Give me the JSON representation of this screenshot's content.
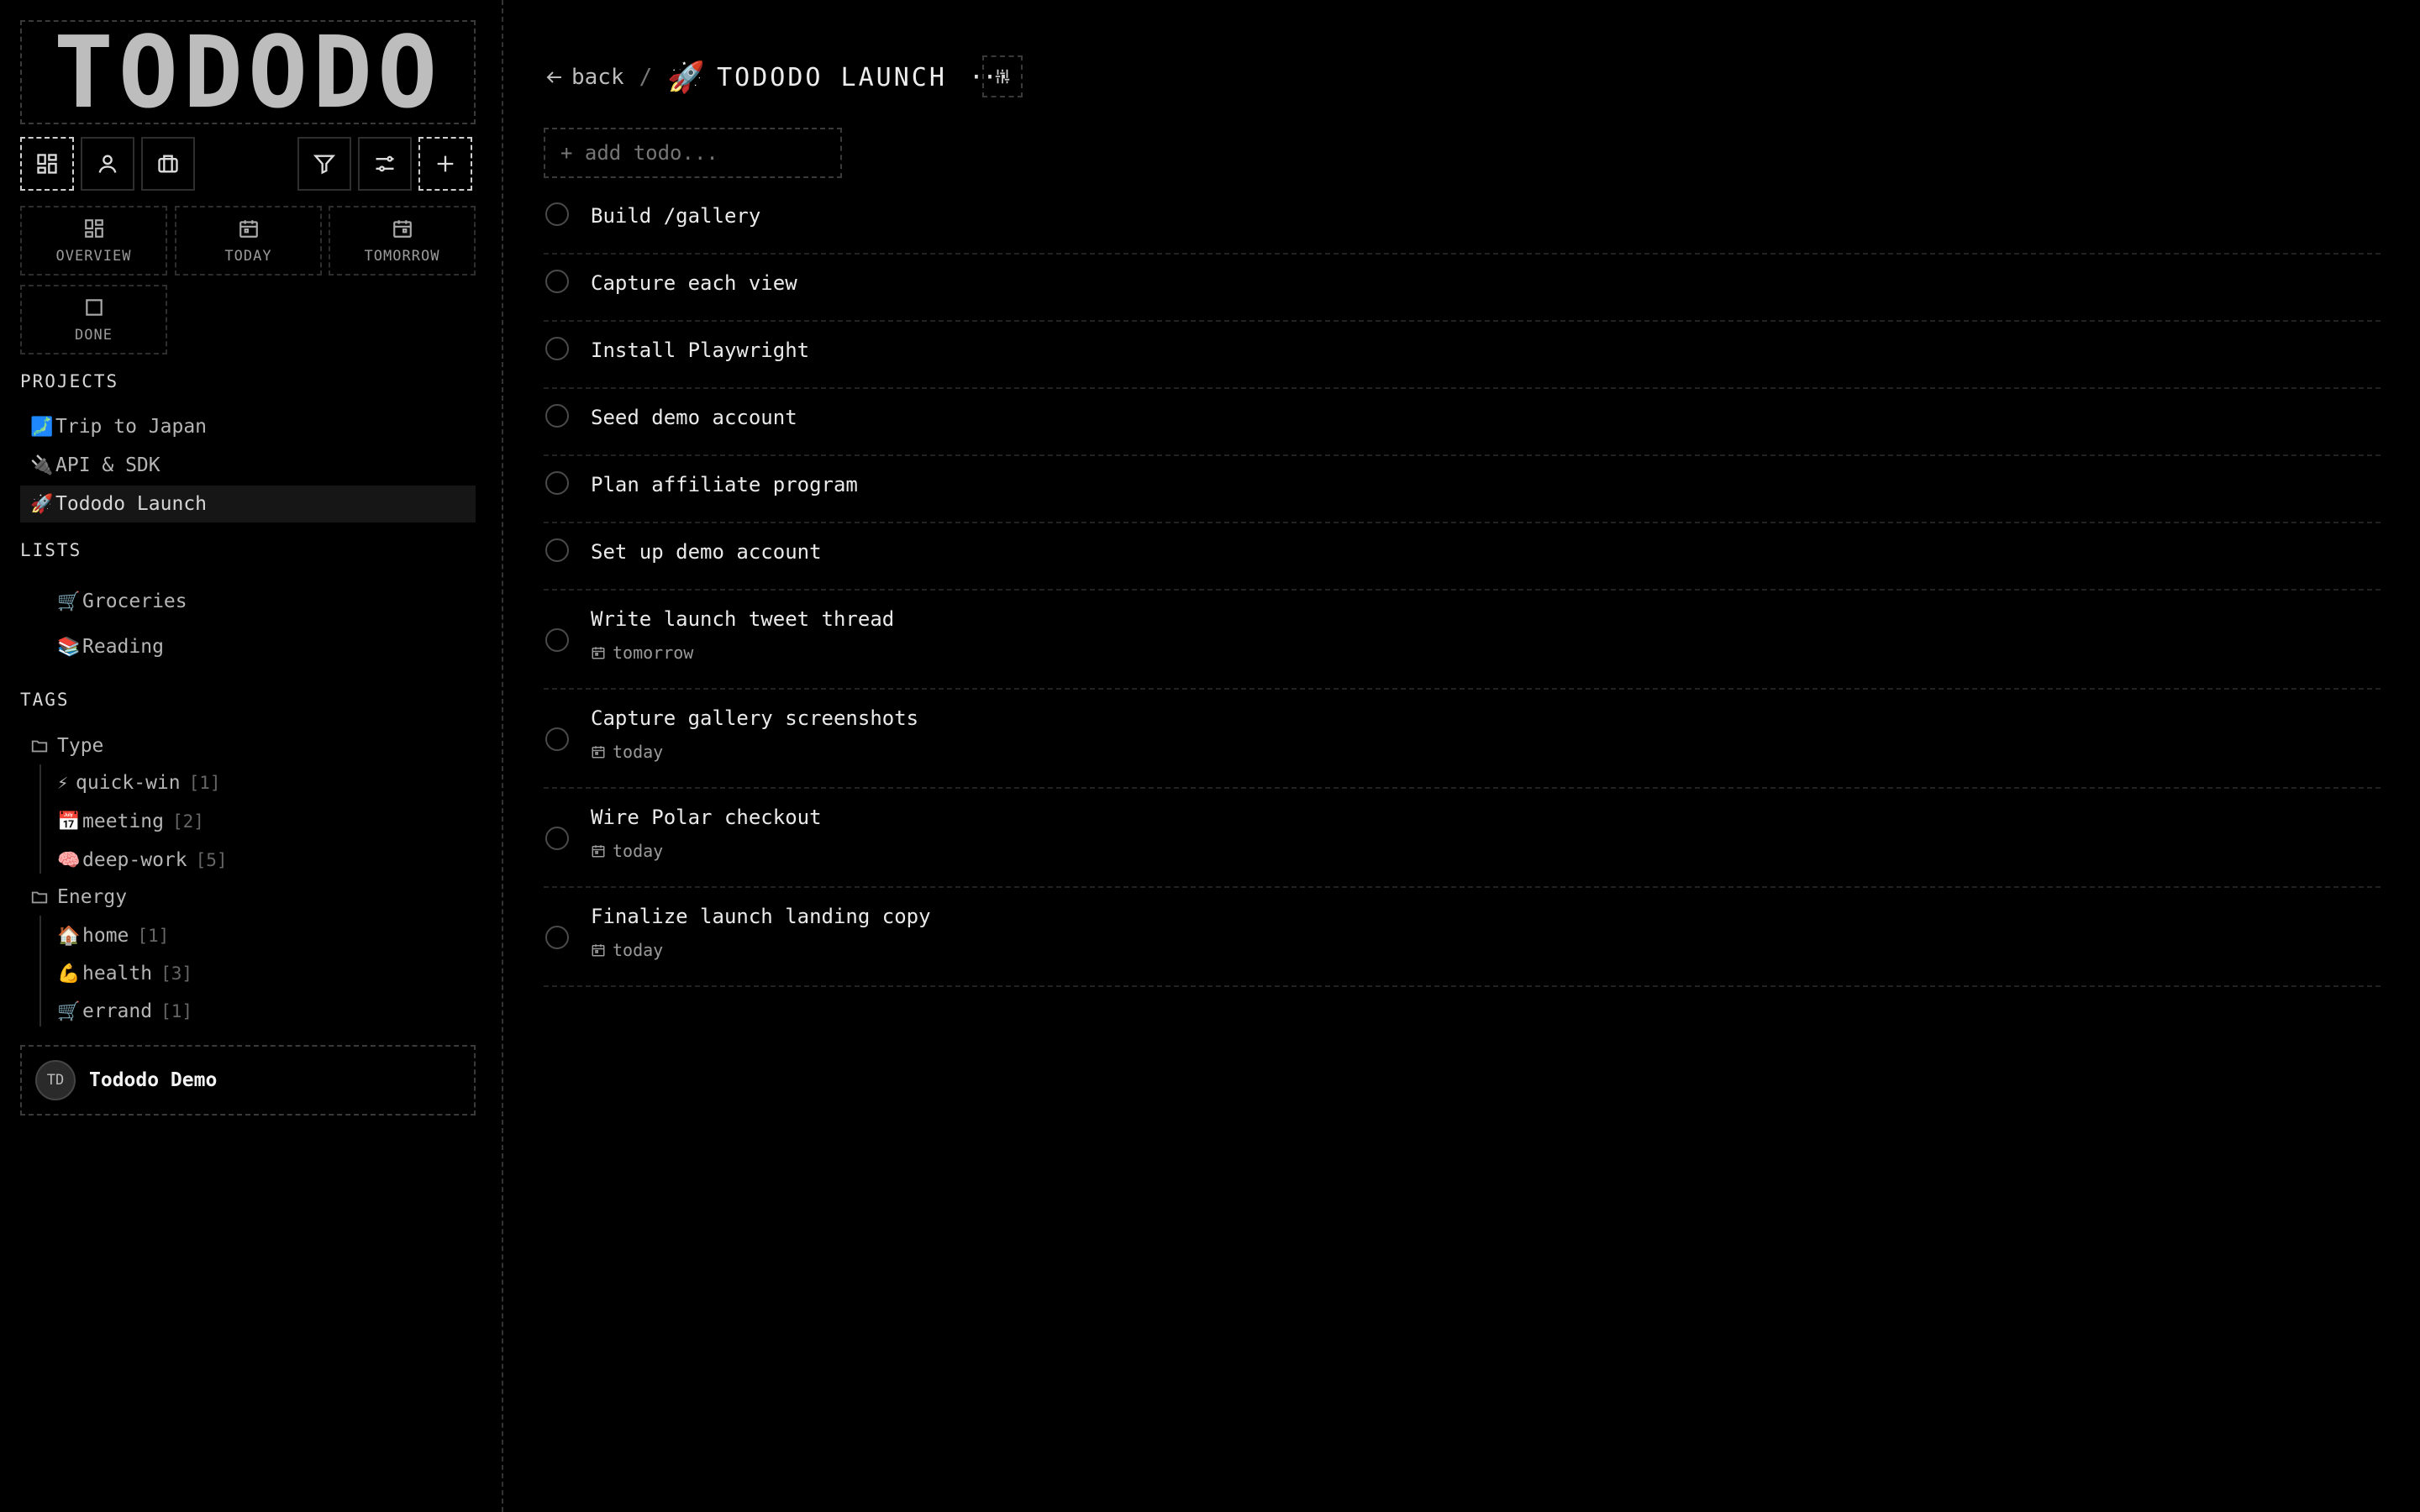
{
  "app": {
    "logo": "TODODO"
  },
  "toolbar": {
    "left_buttons": [
      "grid-icon",
      "person-icon",
      "briefcase-icon"
    ],
    "right_buttons": [
      "filter-icon",
      "sliders-icon",
      "plus-icon"
    ]
  },
  "views": [
    {
      "label": "OVERVIEW",
      "icon": "grid-icon"
    },
    {
      "label": "TODAY",
      "icon": "calendar-icon"
    },
    {
      "label": "TOMORROW",
      "icon": "calendar-icon"
    },
    {
      "label": "DONE",
      "icon": "square-icon"
    }
  ],
  "projects": {
    "heading": "PROJECTS",
    "items": [
      {
        "emoji": "🗾",
        "label": "Trip to Japan"
      },
      {
        "emoji": "🔌",
        "label": "API & SDK"
      },
      {
        "emoji": "🚀",
        "label": "Tododo Launch",
        "active": true
      }
    ]
  },
  "lists": {
    "heading": "LISTS",
    "items": [
      {
        "emoji": "🛒",
        "label": "Groceries"
      },
      {
        "emoji": "📚",
        "label": "Reading"
      }
    ]
  },
  "tags": {
    "heading": "TAGS",
    "groups": [
      {
        "name": "Type",
        "tags": [
          {
            "emoji": "⚡",
            "label": "quick-win",
            "count": "[1]"
          },
          {
            "emoji": "📅",
            "label": "meeting",
            "count": "[2]"
          },
          {
            "emoji": "🧠",
            "label": "deep-work",
            "count": "[5]"
          }
        ]
      },
      {
        "name": "Energy",
        "tags": [
          {
            "emoji": "🏠",
            "label": "home",
            "count": "[1]"
          },
          {
            "emoji": "💪",
            "label": "health",
            "count": "[3]"
          },
          {
            "emoji": "🛒",
            "label": "errand",
            "count": "[1]"
          }
        ]
      }
    ]
  },
  "user": {
    "initials": "TD",
    "name": "Tododo Demo"
  },
  "header": {
    "back_label": "back",
    "separator": "/",
    "project_emoji": "🚀",
    "project_title": "TODODO LAUNCH",
    "more_label": "···"
  },
  "add_todo": {
    "placeholder": "+ add todo..."
  },
  "todos": [
    {
      "title": "Build /gallery",
      "due": ""
    },
    {
      "title": "Capture each view",
      "due": ""
    },
    {
      "title": "Install Playwright",
      "due": ""
    },
    {
      "title": "Seed demo account",
      "due": ""
    },
    {
      "title": "Plan affiliate program",
      "due": ""
    },
    {
      "title": "Set up demo account",
      "due": ""
    },
    {
      "title": "Write launch tweet thread",
      "due": "tomorrow"
    },
    {
      "title": "Capture gallery screenshots",
      "due": "today"
    },
    {
      "title": "Wire Polar checkout",
      "due": "today"
    },
    {
      "title": "Finalize launch landing copy",
      "due": "today"
    }
  ]
}
